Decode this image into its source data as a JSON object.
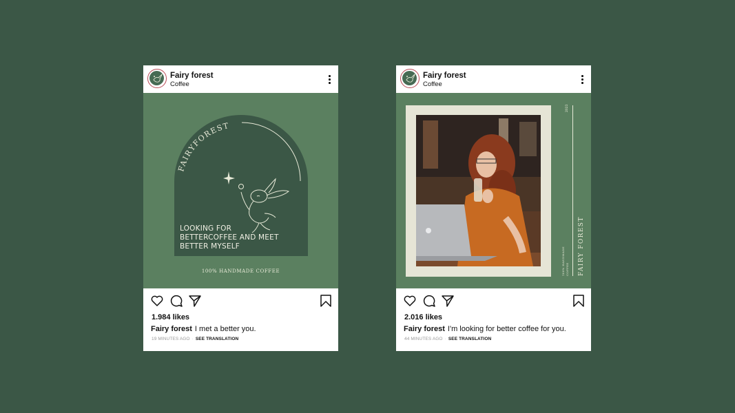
{
  "colors": {
    "background": "#3b5746",
    "card": "#ffffff",
    "media_green": "#5b8060",
    "arch_green": "#3b5746",
    "cream": "#e6e5d6",
    "avatar_ring": "#b84a55"
  },
  "posts": [
    {
      "username": "Fairy forest",
      "subtitle": "Coffee",
      "media": {
        "brand_arc_text": "FAIRYFOREST",
        "tagline_lines": [
          "LOOKING FOR",
          "BETTERCOFFEE AND MEET",
          "BETTER MYSELF"
        ],
        "footer_text": "100% HANDMADE COFFEE"
      },
      "likes": "1.984 likes",
      "caption_user": "Fairy forest",
      "caption_text": "I met a better you.",
      "time": "19 MINUTES AGO",
      "translate": "SEE TRANSLATION",
      "icons": [
        "heart-icon",
        "comment-icon",
        "share-icon",
        "bookmark-icon",
        "more-icon"
      ]
    },
    {
      "username": "Fairy forest",
      "subtitle": "Coffee",
      "media": {
        "side_brand": "FAIRY FOREST",
        "side_small_1": "100% HANDMADE",
        "side_small_2": "COFFEE",
        "side_year": "2023"
      },
      "likes": "2.016 likes",
      "caption_user": "Fairy forest",
      "caption_text": "I'm looking for better coffee for you.",
      "time": "44 MINUTES AGO",
      "translate": "SEE TRANSLATION",
      "icons": [
        "heart-icon",
        "comment-icon",
        "share-icon",
        "bookmark-icon",
        "more-icon"
      ]
    }
  ]
}
